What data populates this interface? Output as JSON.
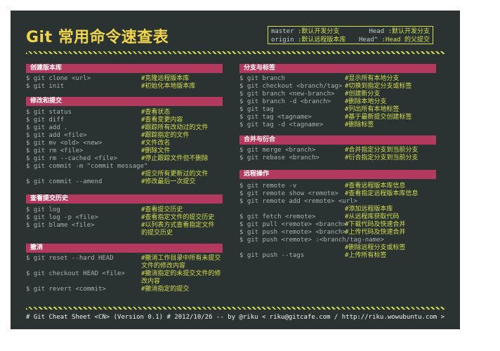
{
  "title": "Git 常用命令速查表",
  "legend": [
    {
      "k1": "master",
      "v1": ":默认开发分支",
      "k2": "Head",
      "v2": ":默认开发分支"
    },
    {
      "k1": "origin",
      "v1": ":默认远程版本库",
      "k2": "Head^",
      "v2": ":Head 的父提交"
    }
  ],
  "sections": {
    "create": {
      "title": "创建版本库",
      "lines": [
        {
          "cmd": "$ git clone <url>",
          "cmt": "#克隆远程版本库"
        },
        {
          "cmd": "$ git init",
          "cmt": "#初始化本地版本库"
        }
      ]
    },
    "modify": {
      "title": "修改和提交",
      "lines": [
        {
          "cmd": "$ git status",
          "cmt": "#查看状态"
        },
        {
          "cmd": "$ git diff",
          "cmt": "#查看变更内容"
        },
        {
          "cmd": "$ git add .",
          "cmt": "#跟踪所有改动过的文件"
        },
        {
          "cmd": "$ git add <file>",
          "cmt": "#跟踪指定的文件"
        },
        {
          "cmd": "$ git mv <old> <new>",
          "cmt": "#文件改名"
        },
        {
          "cmd": "$ git rm <file>",
          "cmt": "#删除文件"
        },
        {
          "cmd": "$ git rm --cached <file>",
          "cmt": "#停止跟踪文件但不删除"
        },
        {
          "cmd": "$ git commit -m \"commit message\"",
          "cmt": ""
        },
        {
          "cmd": "",
          "cmt": "#提交所有更新过的文件"
        },
        {
          "cmd": "$ git commit --amend",
          "cmt": "#修改最后一次提交"
        }
      ]
    },
    "history": {
      "title": "查看提交历史",
      "lines": [
        {
          "cmd": "$ git log",
          "cmt": "#查看提交历史"
        },
        {
          "cmd": "$ git log -p <file>",
          "cmt": "#查看指定文件的提交历史"
        },
        {
          "cmd": "$ git blame <file>",
          "cmt": "#以列表方式查看指定文件"
        },
        {
          "cmd": "",
          "cmt": "的提交历史"
        }
      ]
    },
    "undo": {
      "title": "撤消",
      "lines": [
        {
          "cmd": "$ git reset --hard HEAD",
          "cmt": "#撤消工作目录中所有未提交"
        },
        {
          "cmd": "",
          "cmt": "文件的修改内容"
        },
        {
          "cmd": "$ git checkout HEAD <file>",
          "cmt": "#撤消指定的未提交文件的修"
        },
        {
          "cmd": "",
          "cmt": "改内容"
        },
        {
          "cmd": "$ git revert <commit>",
          "cmt": "#撤消指定的提交"
        }
      ]
    },
    "branch": {
      "title": "分支与标签",
      "lines": [
        {
          "cmd": "$ git branch",
          "cmt": "#显示所有本地分支"
        },
        {
          "cmd": "$ git checkout <branch/tag>",
          "cmt": "#切换到指定分支或标签"
        },
        {
          "cmd": "$ git branch <new-branch>",
          "cmt": "#创建新分支"
        },
        {
          "cmd": "$ git branch -d <branch>",
          "cmt": "#删除本地分支"
        },
        {
          "cmd": "$ git tag",
          "cmt": "#列出所有本地标签"
        },
        {
          "cmd": "$ git tag <tagname>",
          "cmt": "#基于最新提交创建标签"
        },
        {
          "cmd": "$ git tag -d <tagname>",
          "cmt": "#删除标签"
        }
      ]
    },
    "merge": {
      "title": "合并与衍合",
      "lines": [
        {
          "cmd": "$ git merge <branch>",
          "cmt": "#合并指定分支到当前分支"
        },
        {
          "cmd": "$ git rebase <branch>",
          "cmt": "#衍合指定分支到当前分支"
        }
      ]
    },
    "remote": {
      "title": "远程操作",
      "lines": [
        {
          "cmd": "$ git remote -v",
          "cmt": "#查看远程版本库信息"
        },
        {
          "cmd": "$ git remote show <remote>",
          "cmt": "#查看指定远程版本库信息"
        },
        {
          "cmd": "$ git remote add <remote> <url>",
          "cmt": ""
        },
        {
          "cmd": "",
          "cmt": "#添加远程版本库"
        },
        {
          "cmd": "$ git fetch <remote>",
          "cmt": "#从远程库获取代码"
        },
        {
          "cmd": "$ git pull <remote> <branch>",
          "cmt": "#下载代码及快速合并"
        },
        {
          "cmd": "$ git push <remote> <branch>",
          "cmt": "#上传代码及快速合并"
        },
        {
          "cmd": "$ git push <remote> :<branch/tag-name>",
          "cmt": ""
        },
        {
          "cmd": "",
          "cmt": "#删除远程分支或标签"
        },
        {
          "cmd": "$ git push --tags",
          "cmt": "#上传所有标签"
        }
      ]
    }
  },
  "footer": "# Git Cheat Sheet <CN> (Version 0.1)     # 2012/10/26  -- by @riku  < riku@gitcafe.com / http://riku.wowubuntu.com >"
}
